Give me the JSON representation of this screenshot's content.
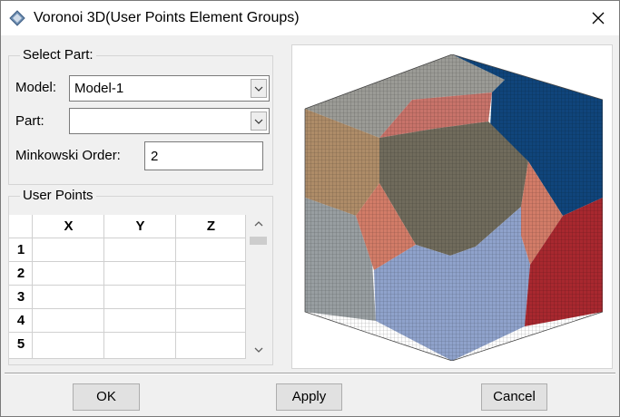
{
  "window": {
    "title": "Voronoi 3D(User Points Element Groups)",
    "app_icon": "abaqus-plugin-icon",
    "close_icon": "close-icon"
  },
  "select_part": {
    "group_title": "Select Part:",
    "model_label": "Model:",
    "model_value": "Model-1",
    "part_label": "Part:",
    "part_value": "",
    "minkowski_label": "Minkowski Order:",
    "minkowski_value": "2"
  },
  "user_points": {
    "group_title": "User Points",
    "columns": [
      "X",
      "Y",
      "Z"
    ],
    "row_numbers": [
      "1",
      "2",
      "3",
      "4",
      "5"
    ]
  },
  "preview": {
    "image": "voronoi-mesh-cube",
    "colors": {
      "top_gray": "#9b9b96",
      "top_salmon": "#c8736a",
      "top_blue": "#10457b",
      "front_dark": "#706b5c",
      "tan": "#ae8c68",
      "salmon": "#d27c68",
      "gray": "#989ea1",
      "light_blue": "#8fa2cb",
      "red": "#a8282f"
    }
  },
  "buttons": {
    "ok": "OK",
    "apply": "Apply",
    "cancel": "Cancel"
  }
}
